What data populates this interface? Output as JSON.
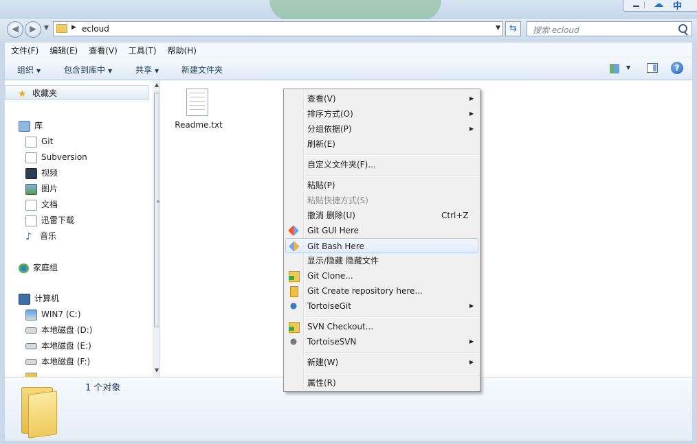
{
  "window": {
    "title_chars": "中"
  },
  "address": {
    "path": "ecloud",
    "search_placeholder": "搜索 ecloud"
  },
  "menubar": [
    "文件(F)",
    "编辑(E)",
    "查看(V)",
    "工具(T)",
    "帮助(H)"
  ],
  "commandbar": {
    "organize": "组织",
    "include_library": "包含到库中",
    "share": "共享",
    "new_folder": "新建文件夹"
  },
  "navpane": {
    "favorites": "收藏夹",
    "libraries": "库",
    "library_items": [
      "Git",
      "Subversion",
      "视频",
      "图片",
      "文档",
      "迅雷下载",
      "音乐"
    ],
    "homegroup": "家庭组",
    "computer": "计算机",
    "drives": [
      "WIN7 (C:)",
      "本地磁盘 (D:)",
      "本地磁盘 (E:)",
      "本地磁盘 (F:)"
    ]
  },
  "content": {
    "file_name": "Readme.txt"
  },
  "details": {
    "count": "1 个对象"
  },
  "context_menu": {
    "view": "查看(V)",
    "sort": "排序方式(O)",
    "group": "分组依据(P)",
    "refresh": "刷新(E)",
    "customize": "自定义文件夹(F)...",
    "paste": "粘贴(P)",
    "paste_shortcut": "粘贴快捷方式(S)",
    "undo": "撤消 删除(U)",
    "undo_shortcut": "Ctrl+Z",
    "git_gui": "Git GUI Here",
    "git_bash": "Git Bash Here",
    "show_hidden": "显示/隐藏 隐藏文件",
    "git_clone": "Git Clone...",
    "git_create": "Git Create repository here...",
    "tortoisegit": "TortoiseGit",
    "svn_checkout": "SVN Checkout...",
    "tortoisesvn": "TortoiseSVN",
    "new": "新建(W)",
    "properties": "属性(R)"
  }
}
